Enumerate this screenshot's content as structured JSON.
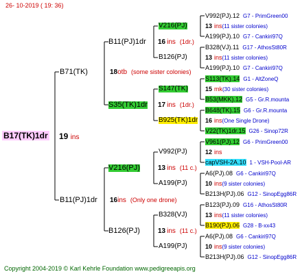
{
  "header": {
    "date": "26- 10-2019 ( 19: 36)"
  },
  "footer": {
    "copyright": "Copyright 2004-2019 © Karl Kehrle Foundation   www.pedigreeapis.org"
  },
  "colors": {
    "green_box": "#33cc33",
    "yellow_box": "#ffee00",
    "cyan_box": "#33e0ff",
    "root_box": "#ffccff",
    "blue_text": "#0000cc",
    "red_text": "#cc0000"
  },
  "pedigree": {
    "root": {
      "name": "B17(TK)1dr",
      "num": "19",
      "word": "ins"
    },
    "g1": [
      {
        "name": "B71(TK)",
        "num": "18",
        "word": "otb",
        "note": "(some sister colonies)"
      },
      {
        "name": "B11(PJ)1dr",
        "num": "16",
        "word": "ins",
        "note": "(Only one drone)"
      }
    ],
    "g2": [
      {
        "name": "B11(PJ)1dr",
        "num": "16",
        "word": "ins",
        "note": "(1dr.)"
      },
      {
        "name": "S35(TK)1dr",
        "num": "17",
        "word": "ins",
        "note": "(1dr.)"
      },
      {
        "name": "V216(PJ)",
        "num": "13",
        "word": "ins",
        "note": "(11 c.)"
      },
      {
        "name": "B126(PJ)",
        "num": "13",
        "word": "ins",
        "note": "(11 c.)"
      }
    ],
    "g3": [
      {
        "name": "V216(PJ)"
      },
      {
        "name": "B126(PJ)"
      },
      {
        "name": "S147(TK)"
      },
      {
        "name": "B925(TK)1dr"
      },
      {
        "name": "V992(PJ)"
      },
      {
        "name": "A199(PJ)"
      },
      {
        "name": "B328(VJ)"
      },
      {
        "name": "A199(PJ)"
      }
    ],
    "g4": [
      {
        "top": "V992(PJ).12",
        "topinfo": "G7 - PrimGreen00",
        "num": "13",
        "word": "ins",
        "note": "(11 sister colonies)",
        "bot": "A199(PJ).10",
        "botinfo": "G7 - Cankiri97Q"
      },
      {
        "top": "B328(VJ).11",
        "topinfo": "G17 - AthosSt80R",
        "num": "13",
        "word": "ins",
        "note": "(11 sister colonies)",
        "bot": "A199(PJ).10",
        "botinfo": "G7 - Cankiri97Q"
      },
      {
        "top": "S113(TK).14",
        "topinfo": "G1 - AltZoneQ",
        "num": "15",
        "word": "mk",
        "note": "(30 sister colonies)",
        "bot": "B53(MKK).12",
        "botinfo": "G5 - Gr.R.mounta"
      },
      {
        "top": "B648(TK).15",
        "topinfo": "G6 - Gr.R.mounta",
        "num": "16",
        "word": "ins",
        "note": "(One Single Drone)",
        "bot": "V22(TK)1dr.15",
        "botinfo": "G26 - Sinop72R"
      },
      {
        "top": "V961(PJ).12",
        "topinfo": "G6 - PrimGreen00",
        "num": "12",
        "word": "ins",
        "note": "",
        "bot": "capVSH-2A.10",
        "botinfo": "1 - VSH-Pool-AR"
      },
      {
        "top": "A6(PJ).08",
        "topinfo": "G6 - Cankiri97Q",
        "num": "10",
        "word": "ins",
        "note": "(9 sister colonies)",
        "bot": "B213H(PJ).06",
        "botinfo": "G12 - SinopEgg86R"
      },
      {
        "top": "B123(PJ).09",
        "topinfo": "G16 - AthosSt80R",
        "num": "13",
        "word": "ins",
        "note": "(11 sister colonies)",
        "bot": "B190(PJ).06",
        "botinfo": "G28 - B-xx43"
      },
      {
        "top": "A6(PJ).08",
        "topinfo": "G6 - Cankiri97Q",
        "num": "10",
        "word": "ins",
        "note": "(9 sister colonies)",
        "bot": "B213H(PJ).06",
        "botinfo": "G12 - SinopEgg86R"
      }
    ]
  }
}
